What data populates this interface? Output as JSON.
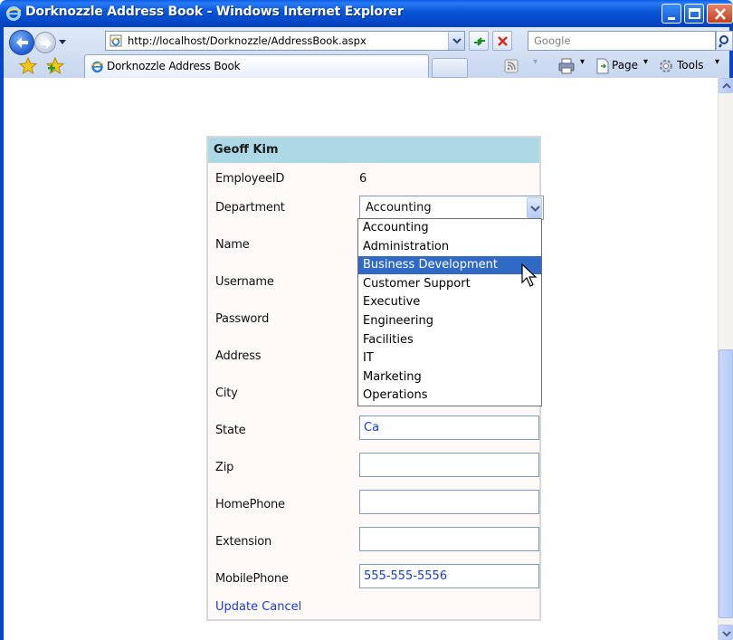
{
  "window": {
    "title": "Dorknozzle Address Book - Windows Internet Explorer"
  },
  "nav": {
    "url": "http://localhost/Dorknozzle/AddressBook.aspx",
    "search_placeholder": "Google"
  },
  "tabs": {
    "active_label": "Dorknozzle Address Book"
  },
  "commands": {
    "page_label": "Page",
    "tools_label": "Tools"
  },
  "form": {
    "employee_name": "Geoff Kim",
    "labels": {
      "employee_id": "EmployeeID",
      "department": "Department",
      "name": "Name",
      "username": "Username",
      "password": "Password",
      "address": "Address",
      "city": "City",
      "state": "State",
      "zip": "Zip",
      "home_phone": "HomePhone",
      "extension": "Extension",
      "mobile_phone": "MobilePhone"
    },
    "values": {
      "employee_id": "6",
      "department": "Accounting",
      "state": "Ca",
      "zip": "",
      "home_phone": "",
      "extension": "",
      "mobile_phone": "555-555-5556"
    },
    "actions": {
      "update": "Update",
      "cancel": "Cancel"
    }
  },
  "department_options": [
    "Accounting",
    "Administration",
    "Business Development",
    "Customer Support",
    "Executive",
    "Engineering",
    "Facilities",
    "IT",
    "Marketing",
    "Operations"
  ],
  "highlighted_option": "Business Development",
  "colors": {
    "header_bg": "#add8e6",
    "selection": "#316ac5",
    "link": "#1a3bd1",
    "titlebar": "#0446c4"
  }
}
